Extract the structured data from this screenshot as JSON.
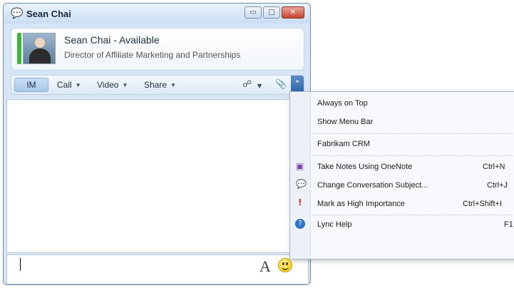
{
  "window": {
    "title": "Sean Chai",
    "title_icon": "conversation-icon",
    "buttons": {
      "minimize": "▭",
      "maximize": "□",
      "close": "✕"
    }
  },
  "contact": {
    "name_status": "Sean Chai - Available",
    "job_title": "Director of Affiliate Marketing and Partnerships",
    "presence_color": "#3db53d"
  },
  "toolbar": {
    "im": "IM",
    "call": "Call",
    "video": "Video",
    "share": "Share",
    "people_icon": "☍",
    "attach_icon": "📎",
    "more_icon": "»"
  },
  "compose": {
    "font_label": "A"
  },
  "menu": {
    "items": [
      {
        "label": "Always on Top",
        "shortcut": "",
        "icon": ""
      },
      {
        "label": "Show Menu Bar",
        "shortcut": "",
        "icon": ""
      },
      {
        "label": "Fabrikam CRM",
        "shortcut": "",
        "icon": ""
      },
      {
        "label": "Take Notes Using OneNote",
        "shortcut": "Ctrl+N",
        "icon": "onenote-icon"
      },
      {
        "label": "Change Conversation Subject...",
        "shortcut": "Ctrl+J",
        "icon": "subject-icon"
      },
      {
        "label": "Mark as High Importance",
        "shortcut": "Ctrl+Shift+I",
        "icon": "importance-icon"
      },
      {
        "label": "Lync Help",
        "shortcut": "F1",
        "icon": "help-icon"
      }
    ]
  },
  "colors": {
    "accent": "#2c63a9",
    "window_bg": "#d6e6f6"
  }
}
